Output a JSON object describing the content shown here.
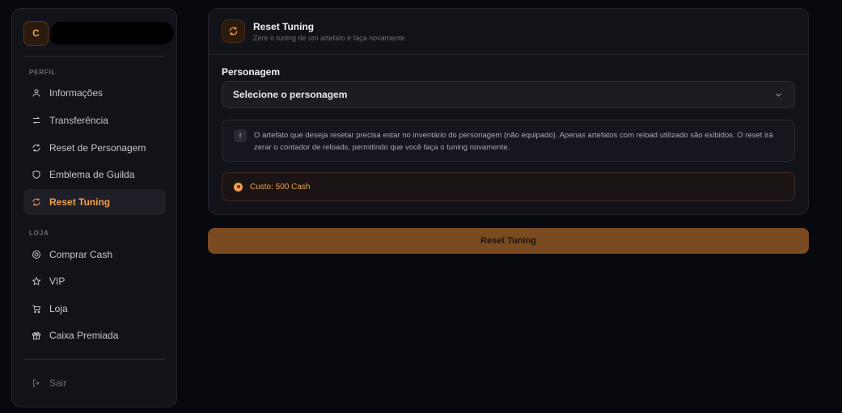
{
  "sidebar": {
    "avatar_initial": "C",
    "sections": {
      "perfil": "PERFIL",
      "loja": "LOJA"
    },
    "items": [
      {
        "label": "Informações",
        "icon": "user-icon"
      },
      {
        "label": "Transferência",
        "icon": "transfer-arrows-icon"
      },
      {
        "label": "Reset de Personagem",
        "icon": "refresh-icon"
      },
      {
        "label": "Emblema de Guilda",
        "icon": "shield-icon"
      },
      {
        "label": "Reset Tuning",
        "icon": "refresh-icon",
        "active": true
      },
      {
        "label": "Comprar Cash",
        "icon": "coin-icon"
      },
      {
        "label": "VIP",
        "icon": "star-icon"
      },
      {
        "label": "Loja",
        "icon": "cart-icon"
      },
      {
        "label": "Caixa Premiada",
        "icon": "gift-icon"
      }
    ],
    "logout_label": "Sair"
  },
  "card": {
    "title": "Reset Tuning",
    "subtitle": "Zere o tuning de um artefato e faça novamente",
    "field_label": "Personagem",
    "select_value": "Selecione o personagem",
    "info_text": "O artefato que deseja resetar precisa estar no inventário do personagem (não equipado). Apenas artefatos com reload utilizado são exibidos. O reset irá zerar o contador de reloads, permitindo que você faça o tuning novamente.",
    "cost_text": "Custo: 500 Cash"
  },
  "submit_label": "Reset Tuning",
  "colors": {
    "accent": "#f0a04b",
    "button": "#7a4a20",
    "background": "#08080f",
    "panel": "#121219"
  }
}
